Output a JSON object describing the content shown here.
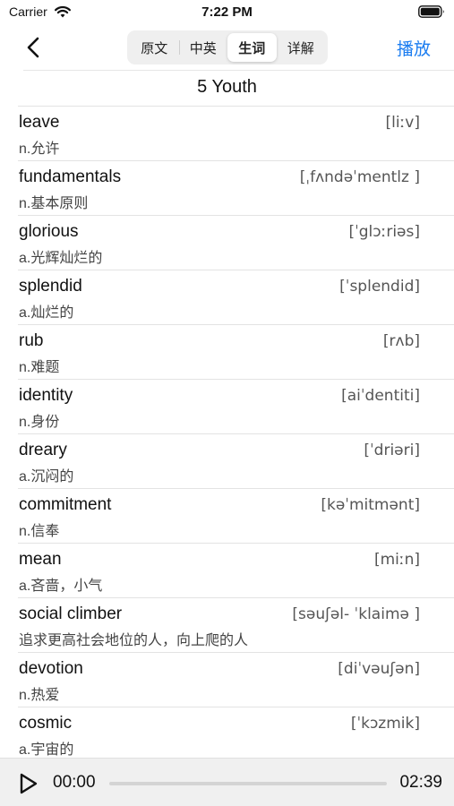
{
  "status": {
    "carrier": "Carrier",
    "time": "7:22 PM"
  },
  "nav": {
    "tabs": [
      {
        "label": "原文",
        "active": false
      },
      {
        "label": "中英",
        "active": false
      },
      {
        "label": "生词",
        "active": true
      },
      {
        "label": "详解",
        "active": false
      }
    ],
    "play_label": "播放"
  },
  "lesson_title": "5 Youth",
  "words": [
    {
      "word": "leave",
      "phonetic": "[liːv]",
      "meaning": "n.允许"
    },
    {
      "word": "fundamentals",
      "phonetic": "[ˌfʌndəˈmentlz ]",
      "meaning": "n.基本原则"
    },
    {
      "word": "glorious",
      "phonetic": "[ˈglɔːriəs]",
      "meaning": "a.光辉灿烂的"
    },
    {
      "word": "splendid",
      "phonetic": "[ˈsplendid]",
      "meaning": "a.灿烂的"
    },
    {
      "word": "rub",
      "phonetic": "[rʌb]",
      "meaning": "n.难题"
    },
    {
      "word": "identity",
      "phonetic": "[aiˈdentiti]",
      "meaning": "n.身份"
    },
    {
      "word": "dreary",
      "phonetic": "[ˈdriəri]",
      "meaning": "a.沉闷的"
    },
    {
      "word": "commitment",
      "phonetic": "[kəˈmitmənt]",
      "meaning": "n.信奉"
    },
    {
      "word": "mean",
      "phonetic": "[miːn]",
      "meaning": "a.吝啬，小气"
    },
    {
      "word": "social climber",
      "phonetic": "[səuʃəl- ˈklaimə ]",
      "meaning": "追求更高社会地位的人，向上爬的人"
    },
    {
      "word": "devotion",
      "phonetic": "[diˈvəuʃən]",
      "meaning": "n.热爱"
    },
    {
      "word": "cosmic",
      "phonetic": "[ˈkɔzmik]",
      "meaning": "a.宇宙的"
    }
  ],
  "player": {
    "current_time": "00:00",
    "total_time": "02:39",
    "progress": 0.0
  },
  "colors": {
    "accent": "#1a7cf0"
  }
}
